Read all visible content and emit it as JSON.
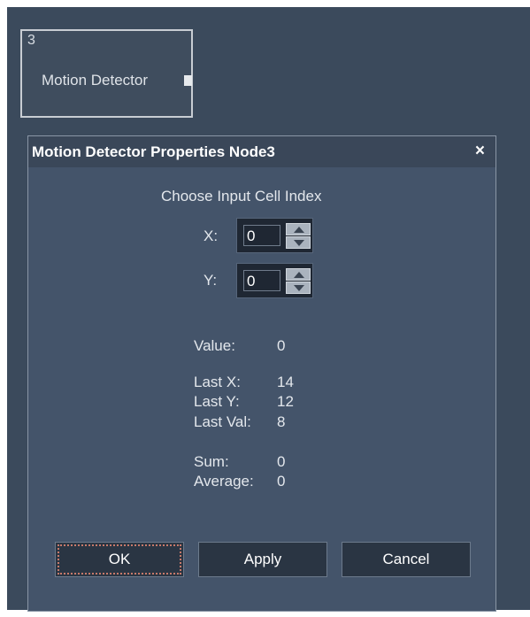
{
  "node": {
    "index": "3",
    "title": "Motion Detector"
  },
  "dialog": {
    "title": "Motion Detector Properties Node3",
    "close_glyph": "×",
    "heading": "Choose Input Cell Index",
    "x_label": "X:",
    "x_value": "0",
    "y_label": "Y:",
    "y_value": "0",
    "value_label": "Value:",
    "value": "0",
    "last_x_label": "Last X:",
    "last_x": "14",
    "last_y_label": "Last Y:",
    "last_y": "12",
    "last_val_label": "Last Val:",
    "last_val": "8",
    "sum_label": "Sum:",
    "sum": "0",
    "average_label": "Average:",
    "average": "0",
    "buttons": {
      "ok": "OK",
      "apply": "Apply",
      "cancel": "Cancel"
    }
  },
  "colors": {
    "canvas": "#3b4a5c",
    "dialog_body": "#44546a",
    "titlebar": "#3a4759",
    "button": "#2a3543",
    "focus_outline": "#c77a6a"
  },
  "icons": {
    "close": "close-icon",
    "spin_up": "chevron-up-icon",
    "spin_down": "chevron-down-icon"
  }
}
